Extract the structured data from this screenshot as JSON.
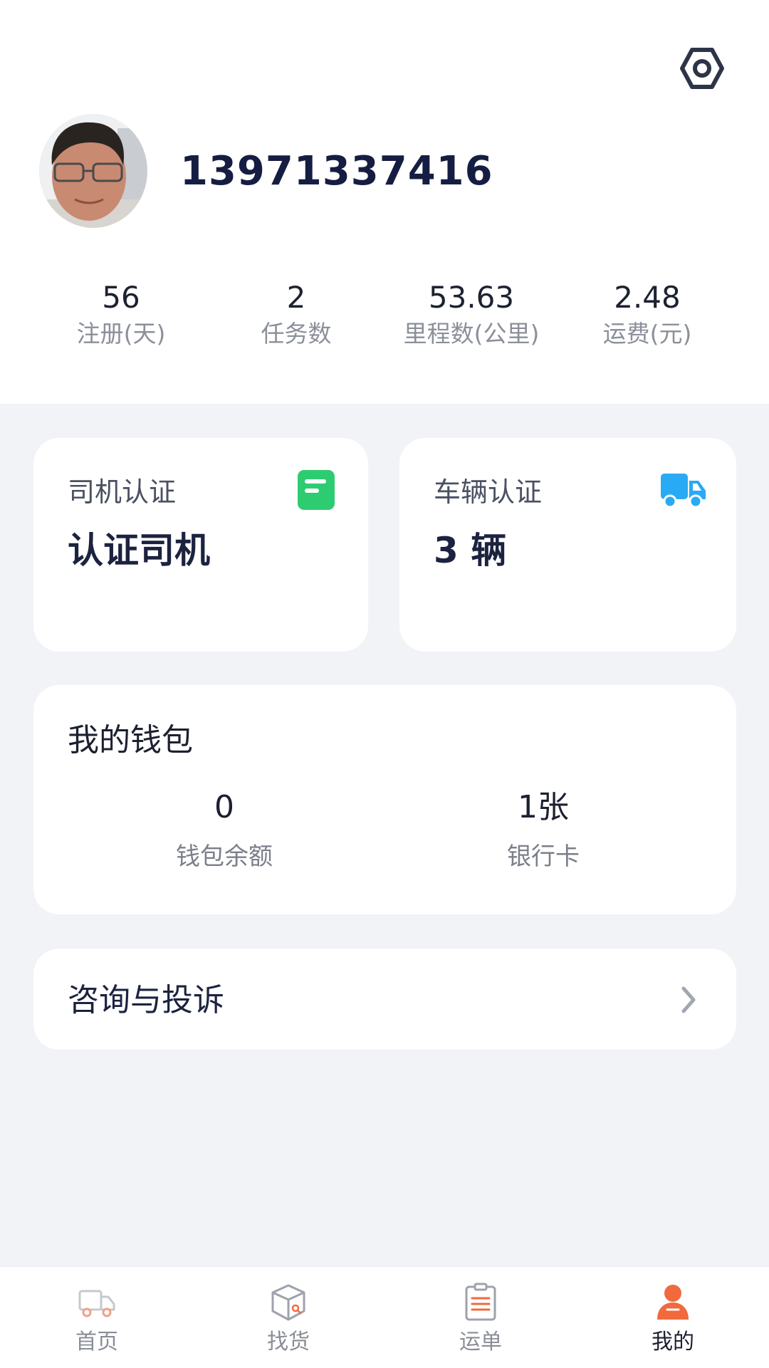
{
  "profile": {
    "phone": "13971337416"
  },
  "stats": [
    {
      "value": "56",
      "label": "注册(天)"
    },
    {
      "value": "2",
      "label": "任务数"
    },
    {
      "value": "53.63",
      "label": "里程数(公里)"
    },
    {
      "value": "2.48",
      "label": "运费(元)"
    }
  ],
  "driver_card": {
    "title": "司机认证",
    "value": "认证司机",
    "icon": "document-icon",
    "icon_color": "#2ecc71"
  },
  "vehicle_card": {
    "title": "车辆认证",
    "value": "3 辆",
    "icon": "truck-icon",
    "icon_color": "#29aaf5"
  },
  "wallet": {
    "title": "我的钱包",
    "balance_value": "0",
    "balance_label": "钱包余额",
    "bankcard_value": "1张",
    "bankcard_label": "银行卡"
  },
  "consult": {
    "label": "咨询与投诉"
  },
  "nav": {
    "items": [
      {
        "label": "首页",
        "icon": "truck-icon"
      },
      {
        "label": "找货",
        "icon": "box-icon"
      },
      {
        "label": "运单",
        "icon": "clipboard-icon"
      },
      {
        "label": "我的",
        "icon": "user-icon"
      }
    ],
    "active_index": 3,
    "accent_color": "#f06a3e"
  }
}
